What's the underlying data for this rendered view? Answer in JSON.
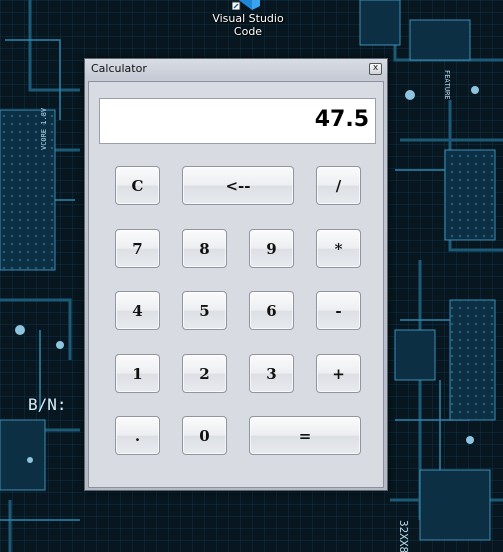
{
  "desktop": {
    "icon_label_line1": "Visual Studio",
    "icon_label_line2": "Code",
    "icon": "visual-studio-code-icon"
  },
  "window": {
    "title": "Calculator",
    "close_label": "x"
  },
  "display": {
    "value": "47.5"
  },
  "keys": {
    "clear": "C",
    "backspace": "<--",
    "divide": "/",
    "seven": "7",
    "eight": "8",
    "nine": "9",
    "multiply": "*",
    "four": "4",
    "five": "5",
    "six": "6",
    "subtract": "-",
    "one": "1",
    "two": "2",
    "three": "3",
    "add": "+",
    "decimal": ".",
    "zero": "0",
    "equals": "="
  }
}
